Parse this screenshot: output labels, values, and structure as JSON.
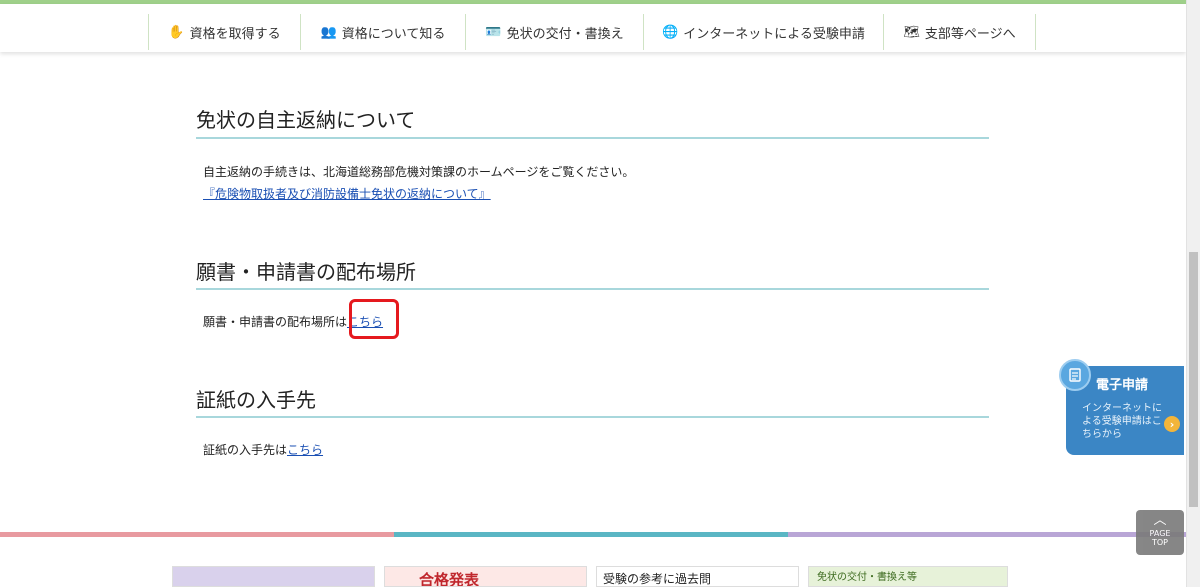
{
  "nav": {
    "items": [
      {
        "label": "資格を取得する",
        "icon": "hand-icon",
        "glyph": "✋"
      },
      {
        "label": "資格について知る",
        "icon": "people-icon",
        "glyph": "👥"
      },
      {
        "label": "免状の交付・書換え",
        "icon": "id-card-icon",
        "glyph": "🪪"
      },
      {
        "label": "インターネットによる受験申請",
        "icon": "globe-icon",
        "glyph": "🌐"
      },
      {
        "label": "支部等ページへ",
        "icon": "map-icon",
        "glyph": "🗺"
      }
    ]
  },
  "sections": {
    "return": {
      "title": "免状の自主返納について",
      "text": "自主返納の手続きは、北海道総務部危機対策課のホームページをご覧ください。",
      "link": "『危険物取扱者及び消防設備士免状の返納について』"
    },
    "distribution": {
      "title": "願書・申請書の配布場所",
      "text": "願書・申請書の配布場所は",
      "link": "こちら"
    },
    "stamp": {
      "title": "証紙の入手先",
      "text": "証紙の入手先は",
      "link": "こちら"
    }
  },
  "eapp": {
    "title": "電子申請",
    "desc": "インターネットによる受験申請はこちらから",
    "icon": "document-icon",
    "arrow": "›"
  },
  "pagetop": {
    "label_line1": "PAGE",
    "label_line2": "TOP",
    "icon": "chevron-up-icon"
  },
  "banners": {
    "b2": "合格発表",
    "b3": "受験の参考に過去問",
    "b4": "免状の交付・書換え等"
  },
  "colors": {
    "accent_green": "#9fd08a",
    "rule": "#a8d7dc",
    "link": "#1a4fb3",
    "highlight": "#e5191e",
    "eapp": "#3b86c5"
  }
}
